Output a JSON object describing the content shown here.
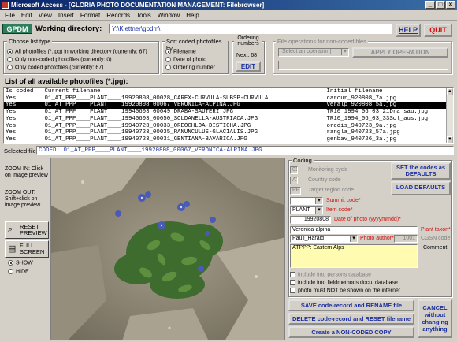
{
  "window": {
    "title": "Microsoft Access - [GLORIA PHOTO DOCUMENTATION MANAGEMENT: Filebrowser]",
    "controls": [
      "_",
      "□",
      "×"
    ]
  },
  "menu": [
    "File",
    "Edit",
    "View",
    "Insert",
    "Format",
    "Records",
    "Tools",
    "Window",
    "Help"
  ],
  "toolbar": {
    "gpdm_label": "GPDM",
    "working_dir_label": "Working directory:",
    "working_dir_value": "Y:\\Klettner\\gpdm\\",
    "help_label": "HELP",
    "quit_label": "QUIT"
  },
  "filelist_type": {
    "title": "Choose list type",
    "options": [
      {
        "label": "All photofiles (*.jpg) in working directory (currently: 67)",
        "selected": true
      },
      {
        "label": "Only non-coded photofiles (currently: 0)",
        "selected": false
      },
      {
        "label": "Only coded photofiles (currently: 67)",
        "selected": false
      }
    ]
  },
  "sort": {
    "title": "Sort coded photofiles by",
    "options": [
      {
        "label": "Filename",
        "selected": true
      },
      {
        "label": "Date of photo",
        "selected": false
      },
      {
        "label": "Ordering number",
        "selected": false
      }
    ]
  },
  "ordering": {
    "title": "Ordering numbers",
    "next_label": "Next: 68",
    "edit_label": "EDIT"
  },
  "file_ops": {
    "title": "File operations for non-coded files",
    "select_placeholder": "[Select an operation]",
    "apply_label": "APPLY OPERATION"
  },
  "list": {
    "heading": "List of all available photofiles (*.jpg):",
    "columns": [
      "Is coded",
      "Current filename",
      "Initial filename"
    ],
    "rows": [
      [
        "Yes",
        "01_AT_PPP____PLANT____19920808_00028_CAREX-CURVULA-SUBSP-CURVULA",
        "carcur_920808_7a.jpg"
      ],
      [
        "Yes",
        "01_AT_PPP____PLANT____19920808_00067_VERONICA-ALPINA.JPG",
        "veralp_920808_5a.jpg"
      ],
      [
        "Yes",
        "01_AT_PPP____PLANT____19940603_00049_DRABA-SAUTERI.JPG",
        "TR10_1994_06_03_21Dra_sau.jpg"
      ],
      [
        "Yes",
        "01_AT_PPP____PLANT____19940603_00050_SOLDANELLA-AUSTRIACA.JPG",
        "TR10_1994_06_03_33Sol_aus.jpg"
      ],
      [
        "Yes",
        "01_AT_PPP____PLANT____19940723_00033_OREOCHLOA-DISTICHA.JPG",
        "oredis_940723_9a.jpg"
      ],
      [
        "Yes",
        "01_AT_PPP____PLANT____19940723_00035_RANUNCULUS-GLACIALIS.JPG",
        "rangla_940723_57a.jpg"
      ],
      [
        "Yes",
        "01_AT_PPP____PLANT____19940723_00031_GENTIANA-BAVARICA.JPG",
        "genbav_940726_3a.jpg"
      ]
    ],
    "selected_index": 1
  },
  "selected_file": {
    "label": "Selected file:",
    "value": "CODED: 01_AT_PPP____PLANT____19920808_00067_VERONICA-ALPINA.JPG"
  },
  "preview": {
    "zoom_in": "ZOOM IN: Click on image preview",
    "zoom_out": "ZOOM OUT: Shift+click on image preview",
    "reset_label": "RESET PREVIEW",
    "full_label": "FULL SCREEN",
    "show_label": "SHOW",
    "hide_label": "HIDE"
  },
  "coding": {
    "title": "Coding",
    "monitoring_value": "01",
    "monitoring_label": "Monitoring cycle",
    "country_value": "AT",
    "country_label": "Country code",
    "region_value": "PPP",
    "region_label": "Target region code",
    "summit_label": "Summit code*",
    "summit_value": "",
    "item_value": "PLANT",
    "item_label": "Item code*",
    "date_value": "19920808",
    "date_label": "Date of photo (yyyymmdd)*",
    "taxon_value": "Veronica-alpina",
    "taxon_label": "Plant taxon*",
    "author_value": "Pauli_Harald",
    "author_label": "Photo author*",
    "cgsn_value": "1001",
    "cgsn_label": "CGSN code",
    "comment_value": "ATPPP: Eastern Alps",
    "comment_label": "Comment",
    "set_defaults_label": "SET the codes as DEFAULTS",
    "load_defaults_label": "LOAD DEFAULTS",
    "check_persons": "include into persons database",
    "check_fieldmethods": "include into fieldmethods docu. database",
    "check_internet": "photo must NOT be shown on the internet"
  },
  "actions": {
    "save_label": "SAVE code-record and RENAME file",
    "delete_label": "DELETE code-record and RESET filename",
    "create_copy_label": "Create a NON-CODED COPY",
    "cancel_label": "CANCEL without changing anything"
  },
  "colors": {
    "title_bar": "#0a246a",
    "gpdm_badge": "#2e7d5b",
    "quit_red": "#d01010",
    "button_blue": "#1b2fa0",
    "comment_yellow": "#fffbb0"
  }
}
